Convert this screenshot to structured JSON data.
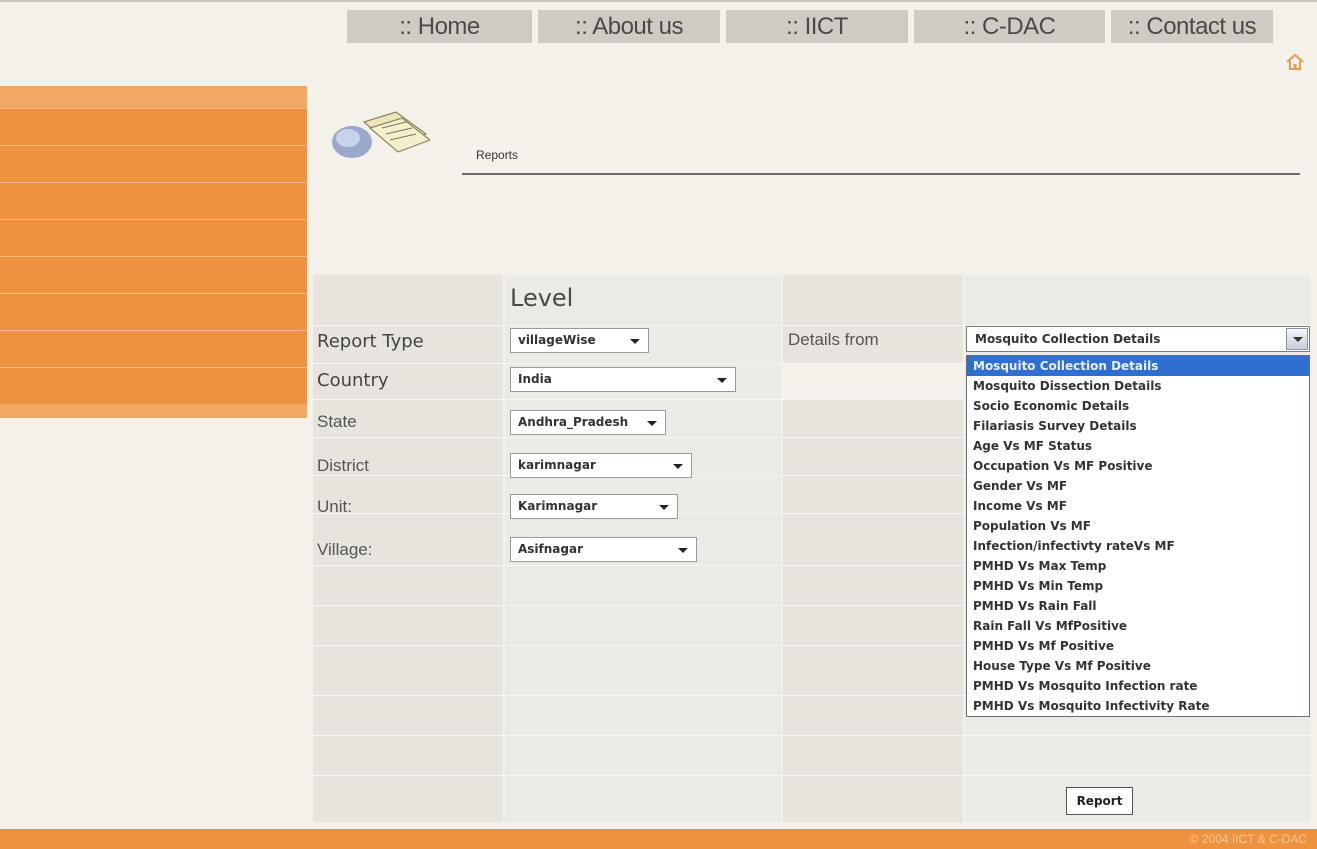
{
  "nav": {
    "items": [
      ":: Home",
      ":: About us",
      ":: IICT",
      ":: C-DAC",
      ":: Contact us"
    ]
  },
  "header": {
    "section_label": "Reports"
  },
  "form": {
    "level_heading": "Level",
    "report_type": {
      "label": "Report Type",
      "value": "villageWise"
    },
    "country": {
      "label": "Country",
      "value": "India"
    },
    "state": {
      "label": "State",
      "value": "Andhra_Pradesh"
    },
    "district": {
      "label": "District",
      "value": "karimnagar"
    },
    "unit": {
      "label": "Unit:",
      "value": "Karimnagar"
    },
    "village": {
      "label": "Village:",
      "value": "Asifnagar"
    },
    "details_from": {
      "label": "Details from",
      "value": "Mosquito Collection Details",
      "options": [
        "Mosquito Collection Details",
        "Mosquito Dissection Details",
        "Socio Economic Details",
        "Filariasis Survey Details",
        "Age Vs MF Status",
        "Occupation Vs MF Positive",
        "Gender Vs MF",
        "Income Vs MF",
        "Population Vs MF",
        "Infection/infectivty rateVs MF",
        "PMHD Vs Max Temp",
        "PMHD Vs Min Temp",
        "PMHD Vs Rain Fall",
        "Rain Fall Vs MfPositive",
        "PMHD Vs Mf Positive",
        "House Type Vs Mf Positive",
        "PMHD Vs Mosquito Infection rate",
        "PMHD Vs Mosquito Infectivity Rate"
      ]
    },
    "report_button": "Report"
  },
  "footer": {
    "copyright": "© 2004 IICT & C-DAC"
  },
  "colors": {
    "accent_orange": "#ee9240",
    "selection_blue": "#2f6fd1"
  }
}
